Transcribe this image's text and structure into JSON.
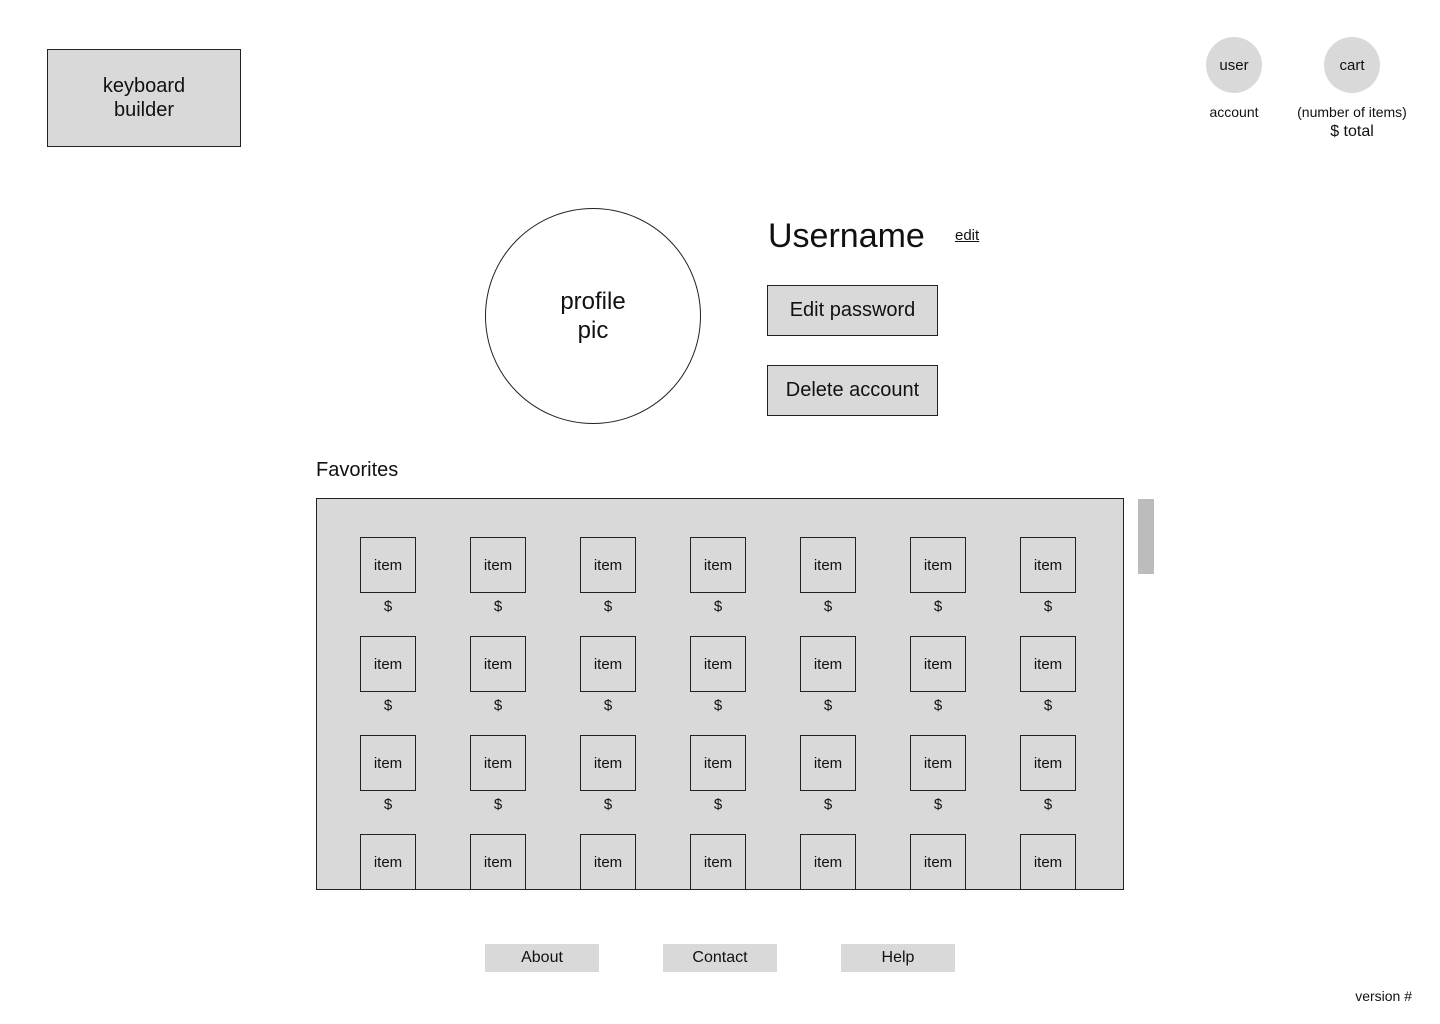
{
  "header": {
    "logo_text": "keyboard\nbuilder",
    "user_icon_label": "user",
    "account_label": "account",
    "cart_icon_label": "cart",
    "cart_count_text": "(number of items)",
    "cart_total_text": "$ total"
  },
  "profile": {
    "pic_text": "profile\npic",
    "username": "Username",
    "edit_label": "edit",
    "edit_password_label": "Edit password",
    "delete_account_label": "Delete account"
  },
  "favorites": {
    "title": "Favorites",
    "rows": [
      [
        {
          "label": "item",
          "price": "$"
        },
        {
          "label": "item",
          "price": "$"
        },
        {
          "label": "item",
          "price": "$"
        },
        {
          "label": "item",
          "price": "$"
        },
        {
          "label": "item",
          "price": "$"
        },
        {
          "label": "item",
          "price": "$"
        },
        {
          "label": "item",
          "price": "$"
        }
      ],
      [
        {
          "label": "item",
          "price": "$"
        },
        {
          "label": "item",
          "price": "$"
        },
        {
          "label": "item",
          "price": "$"
        },
        {
          "label": "item",
          "price": "$"
        },
        {
          "label": "item",
          "price": "$"
        },
        {
          "label": "item",
          "price": "$"
        },
        {
          "label": "item",
          "price": "$"
        }
      ],
      [
        {
          "label": "item",
          "price": "$"
        },
        {
          "label": "item",
          "price": "$"
        },
        {
          "label": "item",
          "price": "$"
        },
        {
          "label": "item",
          "price": "$"
        },
        {
          "label": "item",
          "price": "$"
        },
        {
          "label": "item",
          "price": "$"
        },
        {
          "label": "item",
          "price": "$"
        }
      ],
      [
        {
          "label": "item"
        },
        {
          "label": "item"
        },
        {
          "label": "item"
        },
        {
          "label": "item"
        },
        {
          "label": "item"
        },
        {
          "label": "item"
        },
        {
          "label": "item"
        }
      ]
    ]
  },
  "footer": {
    "links": [
      "About",
      "Contact",
      "Help"
    ],
    "version_text": "version #"
  },
  "colors": {
    "placeholder_gray": "#d9d9d9",
    "scrollbar_gray": "#bcbcbc",
    "border": "#222222"
  }
}
